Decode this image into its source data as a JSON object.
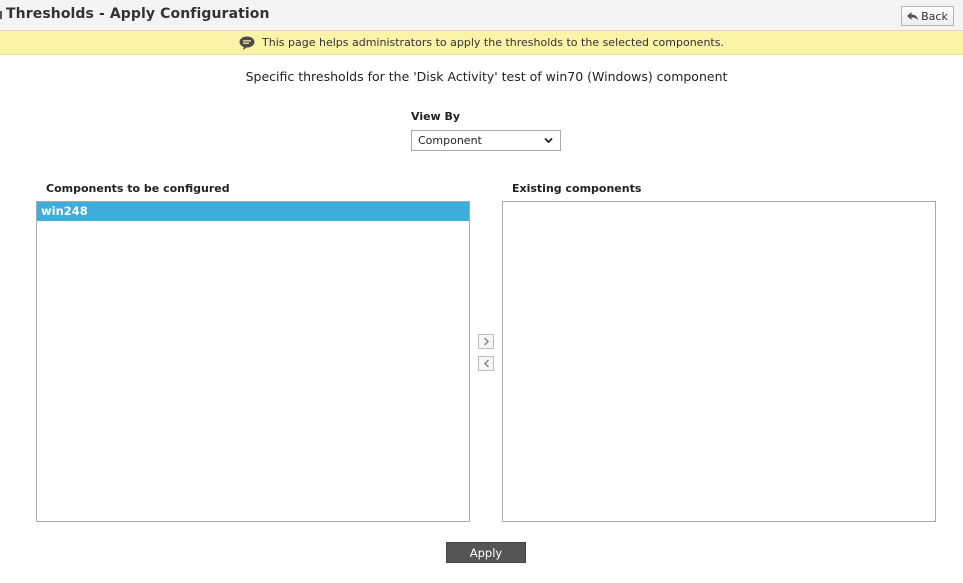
{
  "header": {
    "title": "Thresholds - Apply Configuration",
    "back_label": "Back",
    "back_icon": "reply-arrow-icon"
  },
  "info": {
    "icon": "speech-bubble-icon",
    "message": "This page helps administrators to apply the thresholds to the selected components."
  },
  "subtitle": "Specific thresholds for the 'Disk Activity' test of win70 (Windows) component",
  "view_by": {
    "label": "View By",
    "selected": "Component"
  },
  "left_panel": {
    "label": "Components to be configured",
    "items": [
      {
        "label": "win248",
        "selected": true
      }
    ]
  },
  "right_panel": {
    "label": "Existing components",
    "items": []
  },
  "move_buttons": {
    "right_icon": "chevron-right-icon",
    "left_icon": "chevron-left-icon"
  },
  "apply_label": "Apply",
  "colors": {
    "info_bar": "#fbf3a8",
    "selected_item": "#3daedc",
    "apply_button": "#555555"
  }
}
